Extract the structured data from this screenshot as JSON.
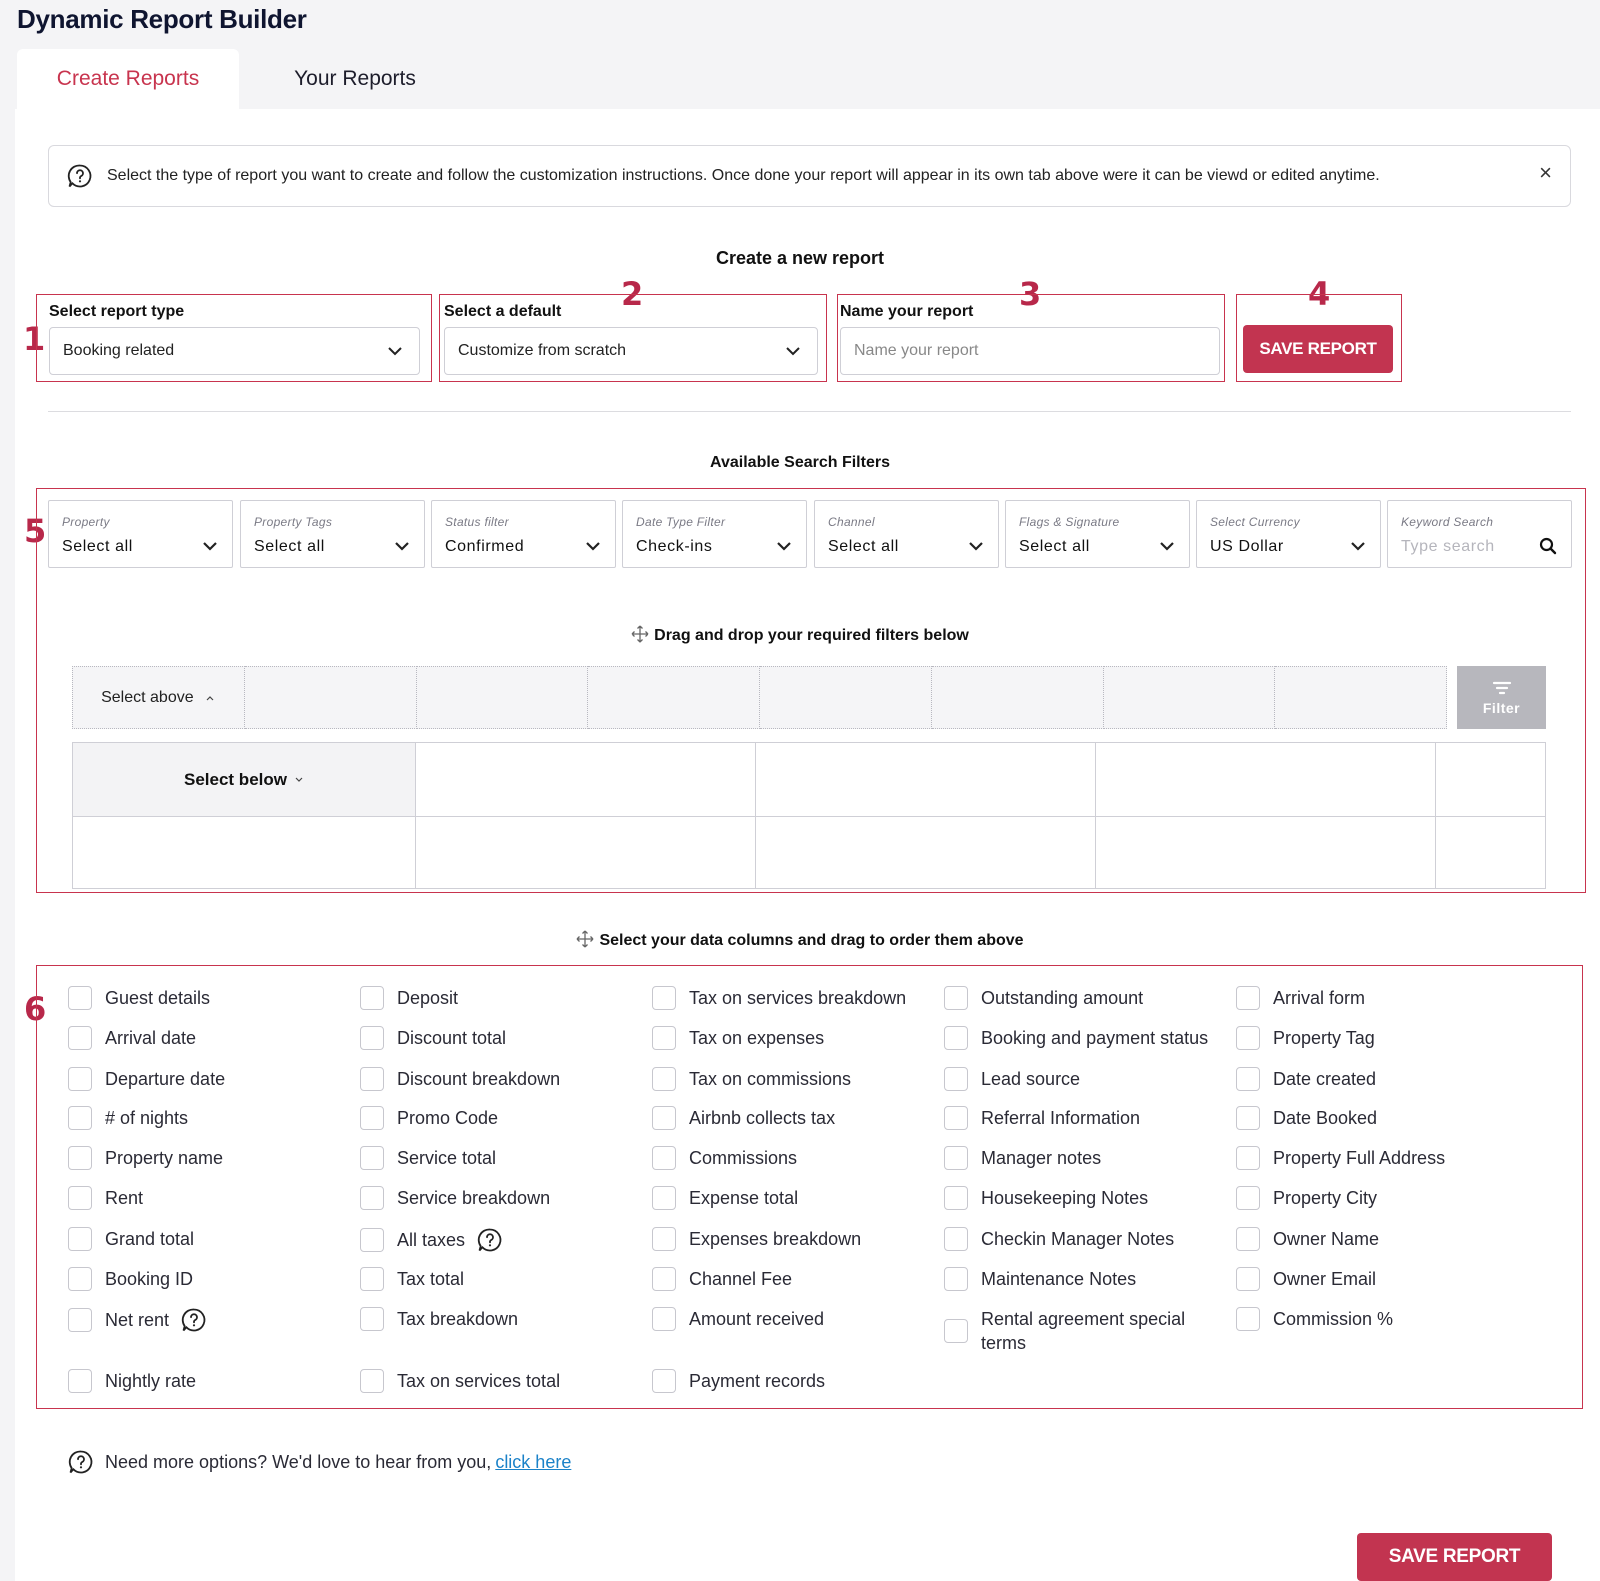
{
  "app_title": "Dynamic Report Builder",
  "tabs": [
    {
      "label": "Create Reports",
      "active": true
    },
    {
      "label": "Your Reports",
      "active": false
    }
  ],
  "banner": {
    "text": "Select the type of report you want to create and follow the customization instructions. Once done your report will appear in its own tab above were it can be viewd or edited anytime.",
    "close": "×"
  },
  "create": {
    "title": "Create a new report",
    "report_type": {
      "label": "Select report type",
      "value": "Booking related"
    },
    "default": {
      "label": "Select a default",
      "value": "Customize from scratch"
    },
    "name": {
      "label": "Name your report",
      "placeholder": "Name your report"
    },
    "save_label": "SAVE REPORT"
  },
  "markers": [
    "1",
    "2",
    "3",
    "4",
    "5",
    "6"
  ],
  "filters": {
    "title": "Available Search Filters",
    "items": [
      {
        "label": "Property",
        "value": "Select all"
      },
      {
        "label": "Property Tags",
        "value": "Select all"
      },
      {
        "label": "Status filter",
        "value": "Confirmed"
      },
      {
        "label": "Date Type Filter",
        "value": "Check-ins"
      },
      {
        "label": "Channel",
        "value": "Select all"
      },
      {
        "label": "Flags & Signature",
        "value": "Select all"
      },
      {
        "label": "Select Currency",
        "value": "US Dollar"
      }
    ],
    "keyword": {
      "label": "Keyword Search",
      "placeholder": "Type search"
    }
  },
  "drag": {
    "title": "Drag and drop your required filters below",
    "select_above": "Select above",
    "filter_button": "Filter",
    "select_below": "Select below"
  },
  "columns": {
    "title": "Select your data columns and drag to order them above",
    "col1": [
      "Guest details",
      "Arrival date",
      "Departure date",
      "# of nights",
      "Property name",
      "Rent",
      "Grand total",
      "Booking ID",
      "Net rent",
      "Nightly rate"
    ],
    "col2": [
      "Deposit",
      "Discount total",
      "Discount breakdown",
      "Promo Code",
      "Service total",
      "Service breakdown",
      "All taxes",
      "Tax total",
      "Tax breakdown",
      "Tax on services total"
    ],
    "col3": [
      "Tax on services breakdown",
      "Tax on expenses",
      "Tax on commissions",
      "Airbnb collects tax",
      "Commissions",
      "Expense total",
      "Expenses breakdown",
      "Channel Fee",
      "Amount received",
      "Payment records"
    ],
    "col4": [
      "Outstanding amount",
      "Booking and payment status",
      "Lead source",
      "Referral Information",
      "Manager notes",
      "Housekeeping Notes",
      "Checkin Manager Notes",
      "Maintenance Notes",
      "Rental agreement special terms"
    ],
    "col5": [
      "Arrival form",
      "Property Tag",
      "Date created",
      "Date Booked",
      "Property Full Address",
      "Property City",
      "Owner Name",
      "Owner Email",
      "Commission %"
    ]
  },
  "footer": {
    "text": "Need more options? We'd love to hear from you,",
    "link": "click here",
    "save_label": "SAVE REPORT"
  },
  "colors": {
    "accent": "#c23450",
    "marker": "#b8284a",
    "link": "#1b82c8"
  },
  "icons": [
    "help-icon",
    "close-icon",
    "chevron-down-icon",
    "search-icon",
    "move-icon",
    "filter-icon",
    "chevron-up-icon"
  ]
}
